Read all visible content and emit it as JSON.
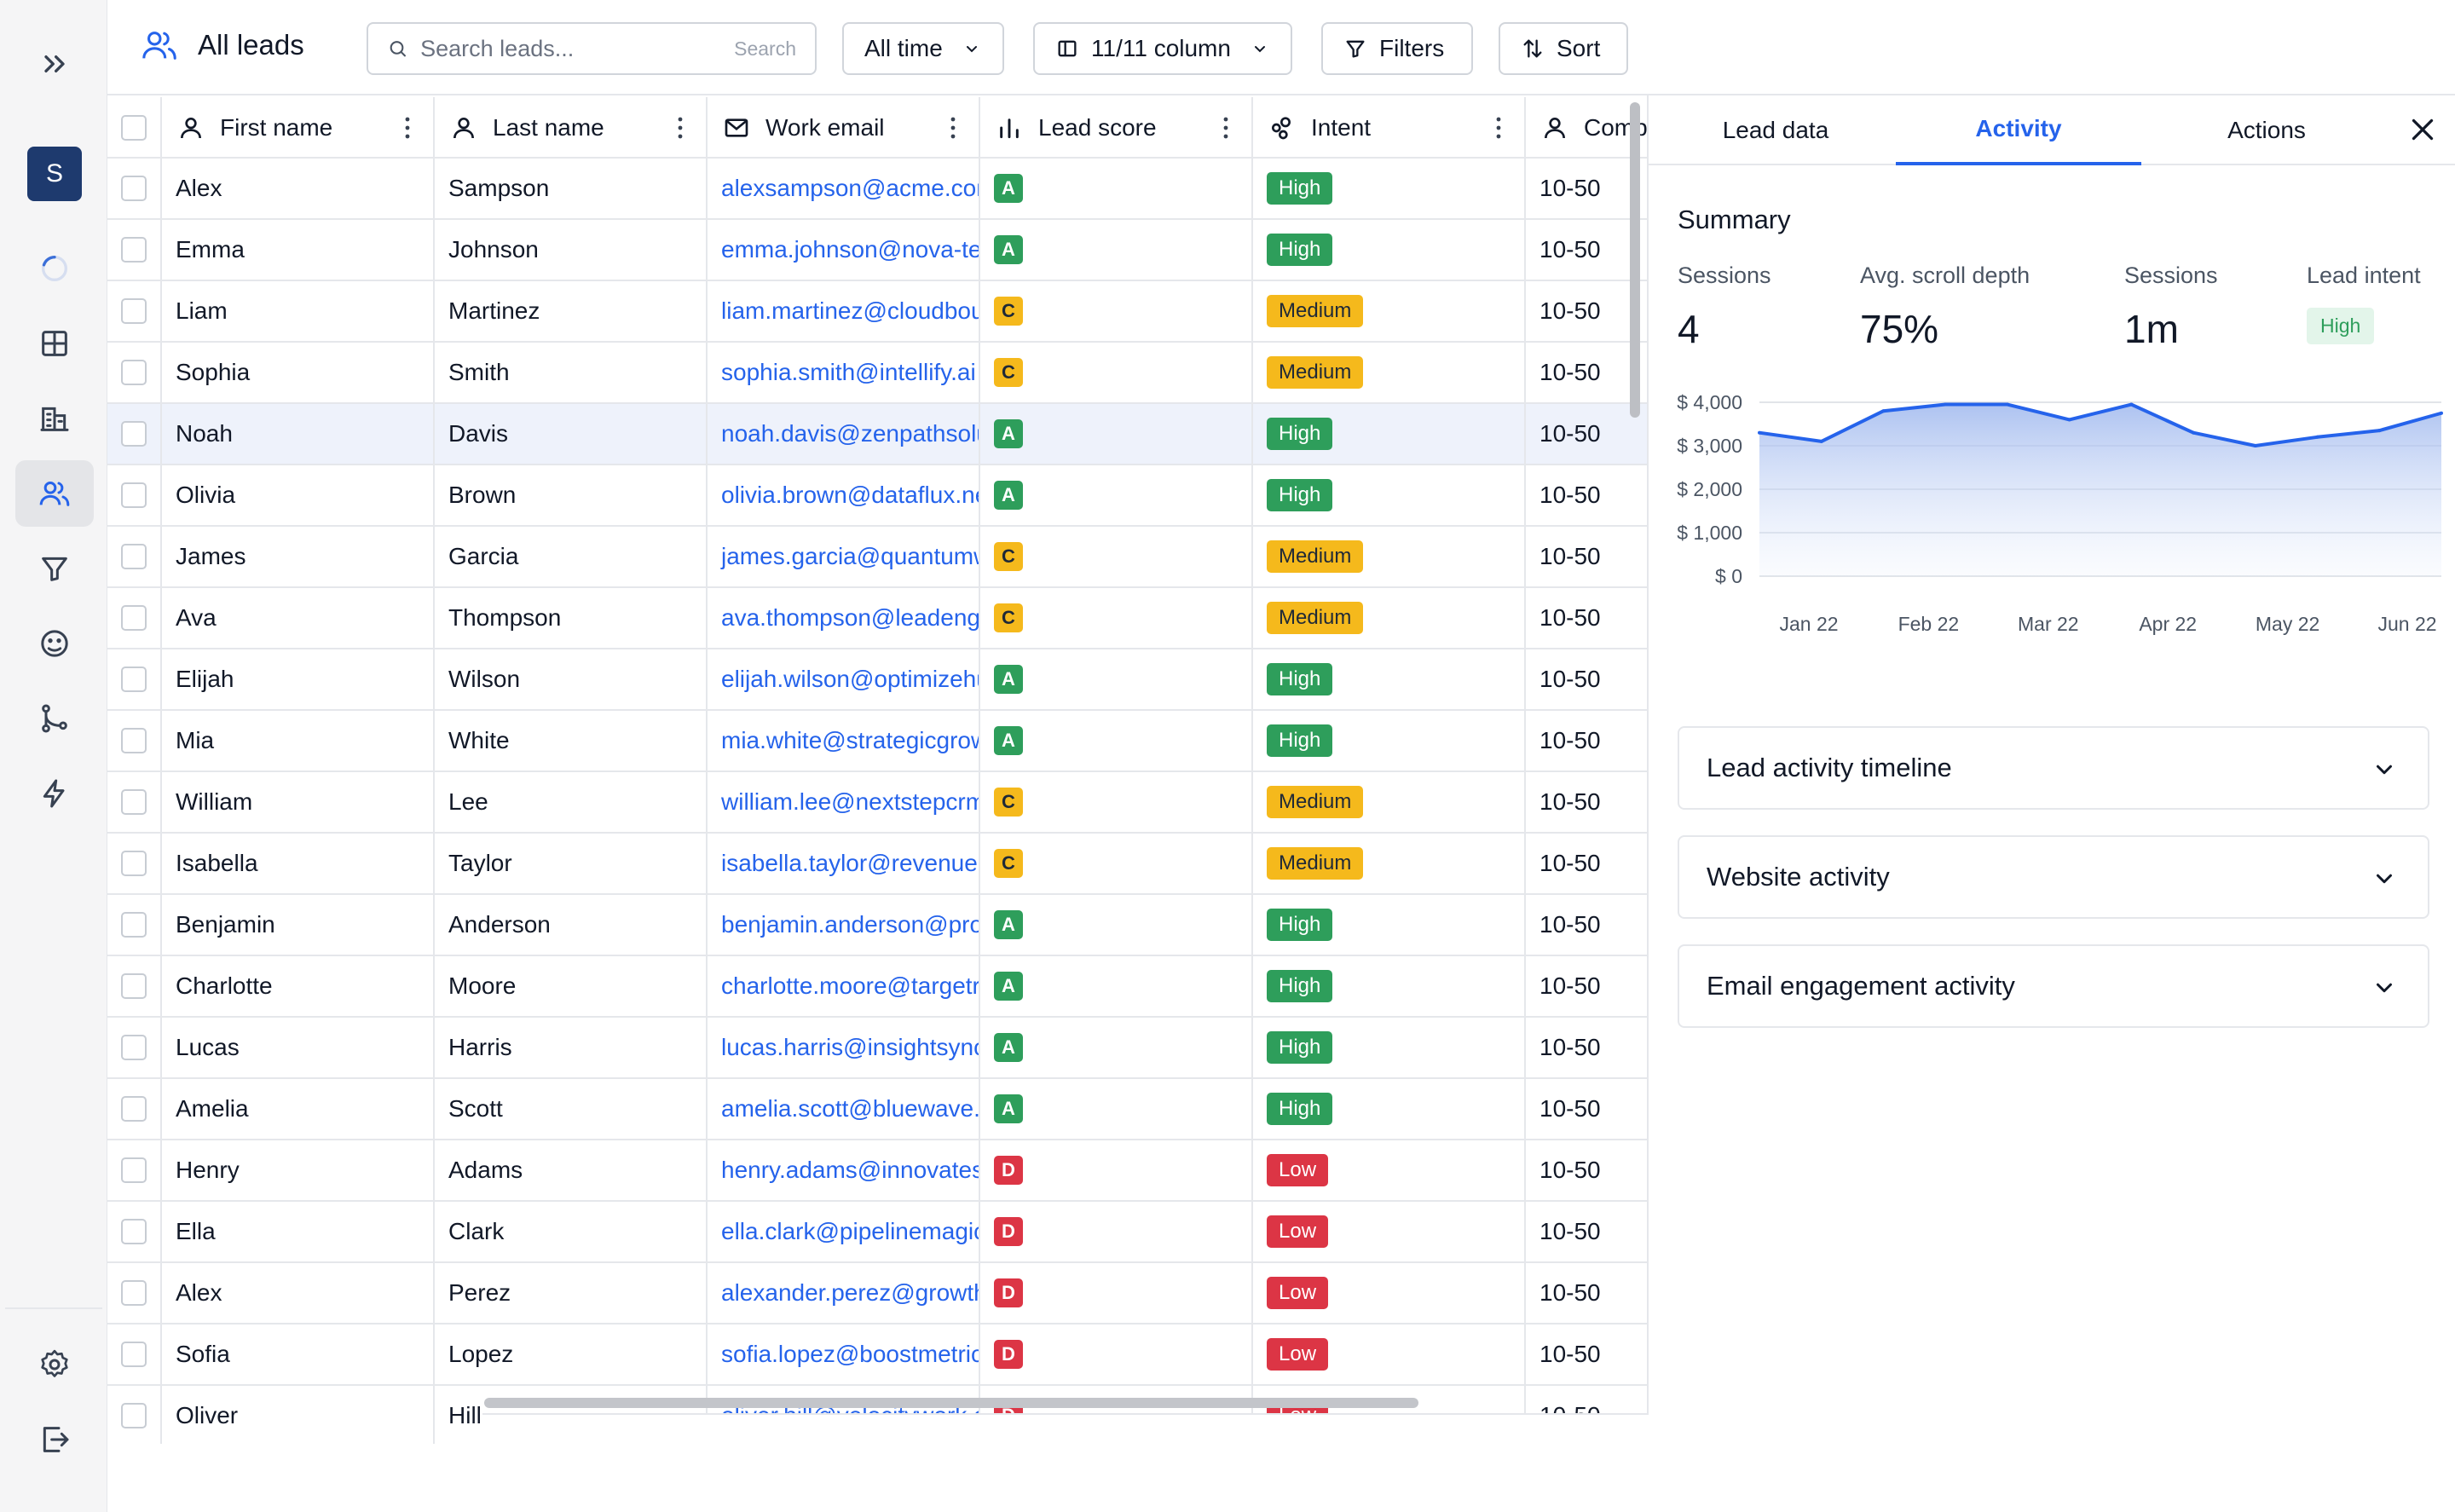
{
  "app": {
    "avatar_letter": "S"
  },
  "toolbar": {
    "title": "All leads",
    "search_placeholder": "Search leads...",
    "search_hint": "Search",
    "time_filter": "All time",
    "columns_label": "11/11 column",
    "filters_label": "Filters",
    "sort_label": "Sort"
  },
  "table": {
    "headers": {
      "first_name": "First name",
      "last_name": "Last name",
      "work_email": "Work email",
      "lead_score": "Lead score",
      "intent": "Intent",
      "company": "Company"
    },
    "rows": [
      {
        "first": "Alex",
        "last": "Sampson",
        "email": "alexsampson@acme.com",
        "score": "A",
        "intent": "High",
        "company": "10-50"
      },
      {
        "first": "Emma",
        "last": "Johnson",
        "email": "emma.johnson@nova-tech.io",
        "score": "A",
        "intent": "High",
        "company": "10-50"
      },
      {
        "first": "Liam",
        "last": "Martinez",
        "email": "liam.martinez@cloudbound.com",
        "score": "C",
        "intent": "Medium",
        "company": "10-50"
      },
      {
        "first": "Sophia",
        "last": "Smith",
        "email": "sophia.smith@intellify.ai",
        "score": "C",
        "intent": "Medium",
        "company": "10-50"
      },
      {
        "first": "Noah",
        "last": "Davis",
        "email": "noah.davis@zenpathsolutions.com",
        "score": "A",
        "intent": "High",
        "company": "10-50"
      },
      {
        "first": "Olivia",
        "last": "Brown",
        "email": "olivia.brown@dataflux.net",
        "score": "A",
        "intent": "High",
        "company": "10-50"
      },
      {
        "first": "James",
        "last": "Garcia",
        "email": "james.garcia@quantumware.io",
        "score": "C",
        "intent": "Medium",
        "company": "10-50"
      },
      {
        "first": "Ava",
        "last": "Thompson",
        "email": "ava.thompson@leadengine.com",
        "score": "C",
        "intent": "Medium",
        "company": "10-50"
      },
      {
        "first": "Elijah",
        "last": "Wilson",
        "email": "elijah.wilson@optimizehub.com",
        "score": "A",
        "intent": "High",
        "company": "10-50"
      },
      {
        "first": "Mia",
        "last": "White",
        "email": "mia.white@strategicgrowth.com",
        "score": "A",
        "intent": "High",
        "company": "10-50"
      },
      {
        "first": "William",
        "last": "Lee",
        "email": "william.lee@nextstepcrm.com",
        "score": "C",
        "intent": "Medium",
        "company": "10-50"
      },
      {
        "first": "Isabella",
        "last": "Taylor",
        "email": "isabella.taylor@revenuelab.com",
        "score": "C",
        "intent": "Medium",
        "company": "10-50"
      },
      {
        "first": "Benjamin",
        "last": "Anderson",
        "email": "benjamin.anderson@prospectly.com",
        "score": "A",
        "intent": "High",
        "company": "10-50"
      },
      {
        "first": "Charlotte",
        "last": "Moore",
        "email": "charlotte.moore@targetreach.com",
        "score": "A",
        "intent": "High",
        "company": "10-50"
      },
      {
        "first": "Lucas",
        "last": "Harris",
        "email": "lucas.harris@insightsync.com",
        "score": "A",
        "intent": "High",
        "company": "10-50"
      },
      {
        "first": "Amelia",
        "last": "Scott",
        "email": "amelia.scott@bluewave.io",
        "score": "A",
        "intent": "High",
        "company": "10-50"
      },
      {
        "first": "Henry",
        "last": "Adams",
        "email": "henry.adams@innovatesoft.com",
        "score": "D",
        "intent": "Low",
        "company": "10-50"
      },
      {
        "first": "Ella",
        "last": "Clark",
        "email": "ella.clark@pipelinemagic.com",
        "score": "D",
        "intent": "Low",
        "company": "10-50"
      },
      {
        "first": "Alex",
        "last": "Perez",
        "email": "alexander.perez@growthly.com",
        "score": "D",
        "intent": "Low",
        "company": "10-50"
      },
      {
        "first": "Sofia",
        "last": "Lopez",
        "email": "sofia.lopez@boostmetrics.com",
        "score": "D",
        "intent": "Low",
        "company": "10-50"
      },
      {
        "first": "Oliver",
        "last": "Hill",
        "email": "oliver.hill@velocitywork.com",
        "score": "D",
        "intent": "Low",
        "company": "10-50"
      }
    ]
  },
  "panel": {
    "tabs": [
      "Lead data",
      "Activity",
      "Actions"
    ],
    "active_tab": "Activity",
    "summary_title": "Summary",
    "stats": [
      {
        "label": "Sessions",
        "value": "4"
      },
      {
        "label": "Avg. scroll depth",
        "value": "75%"
      },
      {
        "label": "Sessions",
        "value": "1m"
      },
      {
        "label": "Lead intent",
        "value": "High"
      }
    ],
    "accordions": [
      "Lead activity timeline",
      "Website activity",
      "Email engagement activity"
    ]
  },
  "chart_data": {
    "type": "area",
    "x": [
      "Jan 22",
      "",
      "Feb 22",
      "",
      "Mar 22",
      "",
      "Apr 22",
      "",
      "May 22",
      "",
      "Jun 22",
      ""
    ],
    "x_ticks": [
      "Jan 22",
      "Feb 22",
      "Mar 22",
      "Apr 22",
      "May 22",
      "Jun 22"
    ],
    "values": [
      3300,
      3100,
      3800,
      3950,
      3950,
      3600,
      3950,
      3300,
      3000,
      3200,
      3350,
      3750
    ],
    "y_ticks": [
      "$ 4,000",
      "$ 3,000",
      "$ 2,000",
      "$ 1,000",
      "$ 0"
    ],
    "ylim": [
      0,
      4000
    ],
    "grid": true,
    "color": "#2563eb"
  }
}
